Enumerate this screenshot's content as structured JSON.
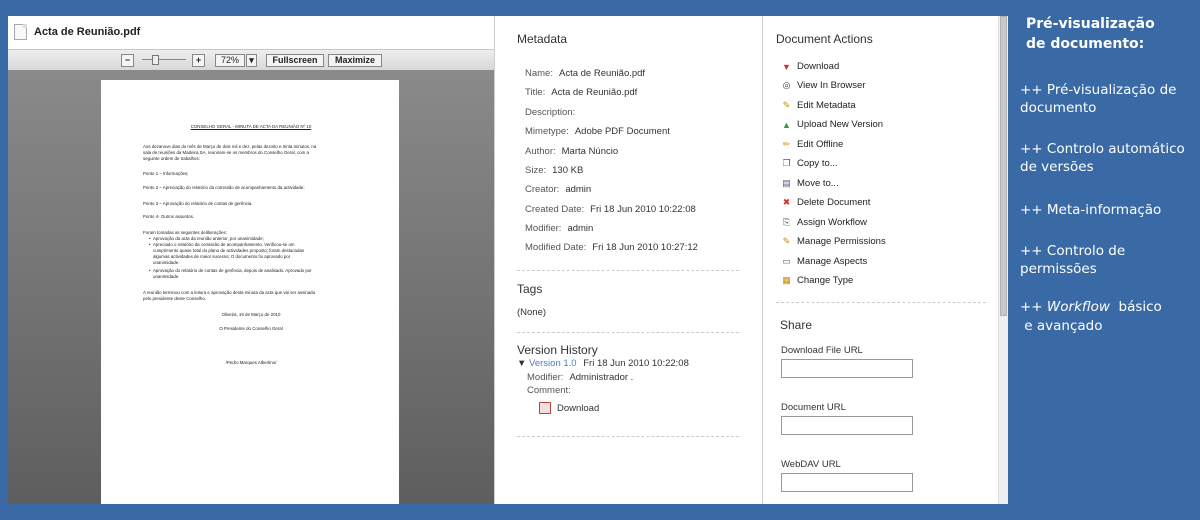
{
  "viewer": {
    "filename": "Acta de Reunião.pdf",
    "toolbar": {
      "minus": "−",
      "plus": "+",
      "zoom": "72%",
      "fullscreen": "Fullscreen",
      "maximize": "Maximize"
    },
    "page_lines": [
      "CONSELHO GERAL - MINUTA DE ACTA DA REUNIÃO Nº 10",
      "Aos dezanove dias do mês de Março de dois mil e dez, pelas dezoito e trinta minutos, na",
      "sala de reuniões da Madeira,SA, reuniram-se os membros do Conselho Geral, com a",
      "seguinte ordem de trabalhos:",
      "Ponto 1 – Informações;",
      "Ponto 2 – Apreciação do relatório da comissão de acompanhamento da actividade;",
      "Ponto 3 – Aprovação do relatório de contas de gerência.",
      "Ponto 4- Outros assuntos.",
      "Foram tomadas as seguintes deliberações:",
      "Aprovação da acta da reunião anterior, por unanimidade;",
      "Apreciado o relatório da comissão de acompanhamento. Verificou-se um",
      "cumprimento quase total do plano de actividades proposto; foram destacadas",
      "algumas actividades de maior sucesso; O documento foi aprovado por",
      "unanimidade.",
      "Aprovação do relatório de contas de gerência, depois de analisado. Aprovado por",
      "unanimidade.",
      "A reunião terminou com a leitura e aprovação desta minuta da acta que vai ser assinada",
      "pelo presidente deste Conselho.",
      "Oliveira, 19 de Março de 2010",
      "O Presidente do Conselho Geral",
      "/Pedro Marques Albertino/"
    ]
  },
  "metadata": {
    "heading": "Metadata",
    "rows": [
      {
        "key": "Name:",
        "value": "Acta de Reunião.pdf"
      },
      {
        "key": "Title:",
        "value": "Acta de Reunião.pdf"
      },
      {
        "key": "Description:",
        "value": ""
      },
      {
        "key": "Mimetype:",
        "value": "Adobe PDF Document"
      },
      {
        "key": "Author:",
        "value": "Marta Núncio"
      },
      {
        "key": "Size:",
        "value": "130 KB"
      },
      {
        "key": "Creator:",
        "value": "admin"
      },
      {
        "key": "Created Date:",
        "value": "Fri 18 Jun 2010 10:22:08"
      },
      {
        "key": "Modifier:",
        "value": "admin"
      },
      {
        "key": "Modified Date:",
        "value": "Fri 18 Jun 2010 10:27:12"
      }
    ],
    "tags_heading": "Tags",
    "tags_value": "(None)",
    "history_heading": "Version History",
    "history": {
      "arrow": "▼",
      "version": "Version 1.0",
      "date": "Fri 18 Jun 2010 10:22:08",
      "modifier_key": "Modifier:",
      "modifier_value": "Administrador .",
      "comment_key": "Comment:",
      "download": "Download"
    }
  },
  "actions": {
    "heading": "Document Actions",
    "items": [
      {
        "label": "Download",
        "icon": "download-icon"
      },
      {
        "label": "View In Browser",
        "icon": "glasses-icon"
      },
      {
        "label": "Edit Metadata",
        "icon": "edit-metadata-icon"
      },
      {
        "label": "Upload New Version",
        "icon": "upload-icon"
      },
      {
        "label": "Edit Offline",
        "icon": "pencil-icon"
      },
      {
        "label": "Copy to...",
        "icon": "copy-icon"
      },
      {
        "label": "Move to...",
        "icon": "move-icon"
      },
      {
        "label": "Delete Document",
        "icon": "delete-icon"
      },
      {
        "label": "Assign Workflow",
        "icon": "workflow-icon"
      },
      {
        "label": "Manage Permissions",
        "icon": "permissions-icon"
      },
      {
        "label": "Manage Aspects",
        "icon": "aspects-icon"
      },
      {
        "label": "Change Type",
        "icon": "change-type-icon"
      }
    ],
    "share_heading": "Share",
    "share_fields": [
      {
        "label": "Download File URL",
        "value": ""
      },
      {
        "label": "Document URL",
        "value": ""
      },
      {
        "label": "WebDAV URL",
        "value": ""
      }
    ]
  },
  "side": {
    "heading_line1": "Pré-visualização",
    "heading_line2": "de documento:",
    "items": [
      {
        "line1": "++ Pré-visualização de",
        "line2": "documento"
      },
      {
        "line1": "++ Controlo automático",
        "line2": "de versões"
      },
      {
        "line1": "++ Meta-informação",
        "line2": ""
      },
      {
        "line1": "++ Controlo de",
        "line2": "permissões"
      },
      {
        "line1a": "++ ",
        "line1b": "Workflow",
        "line1c": "  básico",
        "line2": " e avançado"
      }
    ]
  },
  "colors": {
    "background": "#3a6aa5",
    "link": "#4a7fc0"
  }
}
